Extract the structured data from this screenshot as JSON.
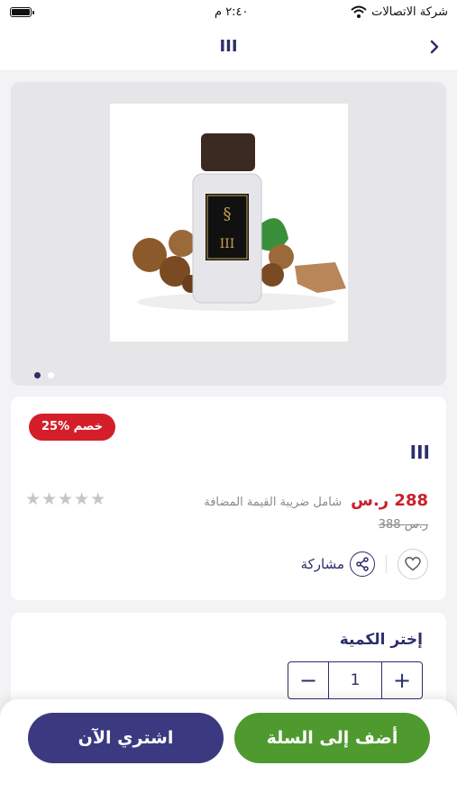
{
  "status_bar": {
    "carrier": "شركة الاتصالات",
    "time": "٢:٤٠ م"
  },
  "nav": {
    "title": "III"
  },
  "product": {
    "name": "III",
    "discount_badge": "خصم %25",
    "price": "288 ر.س",
    "vat_note": "شامل ضريبة القيمة المضافة",
    "old_price": "388 ر.س",
    "rating": {
      "value": 0,
      "max": 5,
      "stars": "★★★★★"
    },
    "share_label": "مشاركة",
    "bottle_label": "III",
    "image_dots": 2,
    "active_dot": 0
  },
  "quantity": {
    "title": "إختر الكمية",
    "value": "1",
    "minus": "−",
    "plus": "+"
  },
  "buttons": {
    "buy_now": "اشتري الآن",
    "add_to_cart": "أضف إلى السلة"
  },
  "colors": {
    "primary": "#2d2e6b",
    "sale_red": "#c8202a",
    "cart_green": "#4f9a2f",
    "buy_purple": "#3b3a80"
  },
  "icons": {
    "back": "chevron-right-icon",
    "wifi": "wifi-icon",
    "battery": "battery-icon",
    "heart": "heart-icon",
    "share": "share-icon"
  }
}
